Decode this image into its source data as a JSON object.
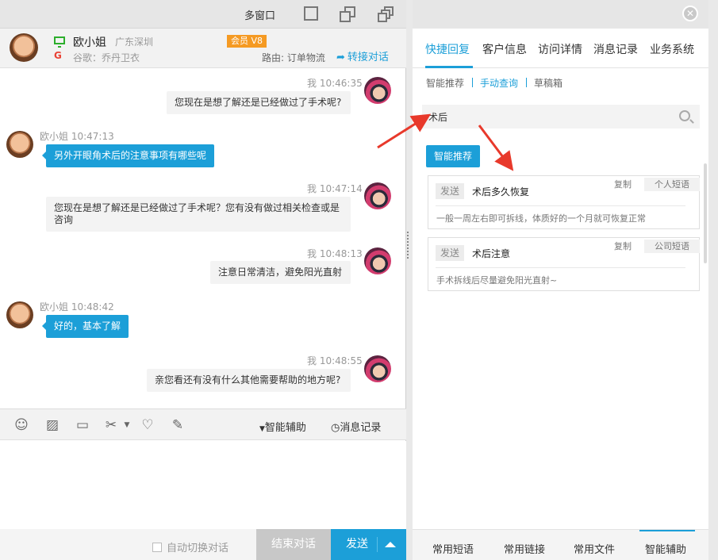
{
  "window": {
    "multi_window": "多窗口"
  },
  "visitor": {
    "name": "欧小姐",
    "location": "广东深圳",
    "member_badge": "会员 V8",
    "source": "谷歌：乔丹卫衣",
    "route": "路由: 订单物流",
    "transfer": "转接对话"
  },
  "messages": [
    {
      "from": "me",
      "time": "我 10:46:35",
      "text": "您现在是想了解还是已经做过了手术呢?"
    },
    {
      "from": "customer",
      "time": "欧小姐 10:47:13",
      "text": "另外开眼角术后的注意事项有哪些呢"
    },
    {
      "from": "me",
      "time": "我 10:47:14",
      "text": "您现在是想了解还是已经做过了手术呢？您有没有做过相关检查或是咨询"
    },
    {
      "from": "me",
      "time": "我 10:48:13",
      "text": "注意日常清洁，避免阳光直射"
    },
    {
      "from": "customer",
      "time": "欧小姐 10:48:42",
      "text": "好的，基本了解"
    },
    {
      "from": "me",
      "time": "我 10:48:55",
      "text": "亲您看还有没有什么其他需要帮助的地方呢?"
    }
  ],
  "toolbar": {
    "smart_assist": "智能辅助",
    "message_log": "消息记录"
  },
  "footer": {
    "auto_switch": "自动切换对话",
    "end_chat": "结束对话",
    "send": "发送"
  },
  "right_panel": {
    "tabs": [
      "快捷回复",
      "客户信息",
      "访问详情",
      "消息记录",
      "业务系统"
    ],
    "active_tab": "快捷回复",
    "sub_tabs": [
      "智能推荐",
      "手动查询",
      "草稿箱"
    ],
    "active_sub_tab": "手动查询",
    "search_value": "术后",
    "smart_recommend_button": "智能推荐",
    "results": [
      {
        "send": "发送",
        "title": "术后多久恢复",
        "copy": "复制",
        "category": "个人短语",
        "desc": "一般一周左右即可拆线，体质好的一个月就可恢复正常"
      },
      {
        "send": "发送",
        "title": "术后注意",
        "copy": "复制",
        "category": "公司短语",
        "desc": "手术拆线后尽量避免阳光直射~"
      }
    ],
    "bottom_tabs": [
      "常用短语",
      "常用链接",
      "常用文件",
      "智能辅助"
    ],
    "active_bottom_tab": "智能辅助"
  },
  "colors": {
    "accent": "#1c9fd8",
    "member": "#f59a23",
    "annotation_arrow": "#e8392b"
  }
}
